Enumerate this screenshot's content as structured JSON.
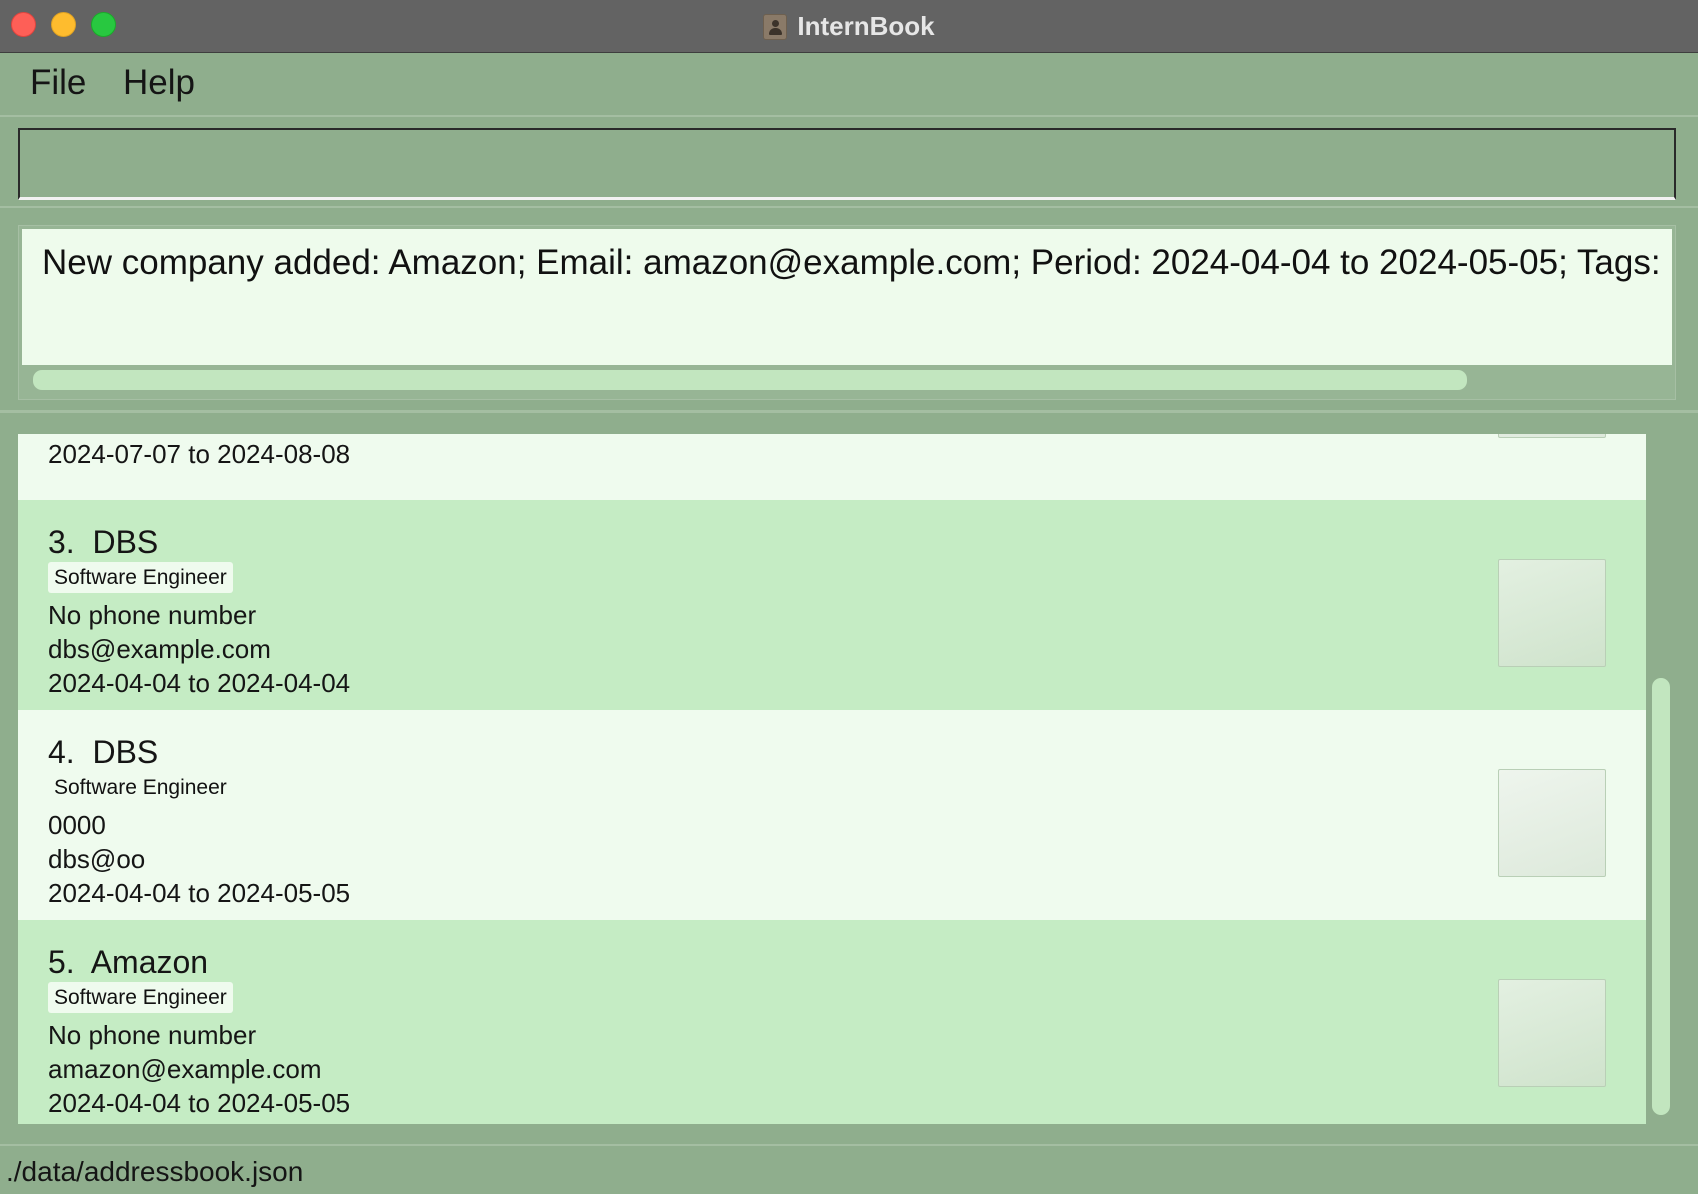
{
  "window": {
    "title": "InternBook",
    "icon": "address-book-icon"
  },
  "menu": {
    "file": "File",
    "help": "Help"
  },
  "command": {
    "value": "",
    "placeholder": ""
  },
  "result": {
    "message": "New company added: Amazon; Email: amazon@example.com; Period: 2024-04-04 to 2024-05-05; Tags: [Software Engineer]"
  },
  "companies": [
    {
      "name": "",
      "tag": "",
      "phone": "",
      "email": "",
      "period": "2024-07-07 to 2024-08-08"
    },
    {
      "name": "3.  DBS",
      "tag": "Software Engineer",
      "phone": "No phone number",
      "email": "dbs@example.com",
      "period": "2024-04-04 to 2024-04-04"
    },
    {
      "name": "4.  DBS",
      "tag": "Software Engineer",
      "phone": "0000",
      "email": "dbs@oo",
      "period": "2024-04-04 to 2024-05-05"
    },
    {
      "name": "5.  Amazon",
      "tag": "Software Engineer",
      "phone": "No phone number",
      "email": "amazon@example.com",
      "period": "2024-04-04 to 2024-05-05"
    }
  ],
  "status": {
    "file_path": "./data/addressbook.json"
  },
  "colors": {
    "background": "#8fae8d",
    "card_light": "#effbee",
    "card_green": "#c5ecc4",
    "title_bar": "#636363"
  }
}
